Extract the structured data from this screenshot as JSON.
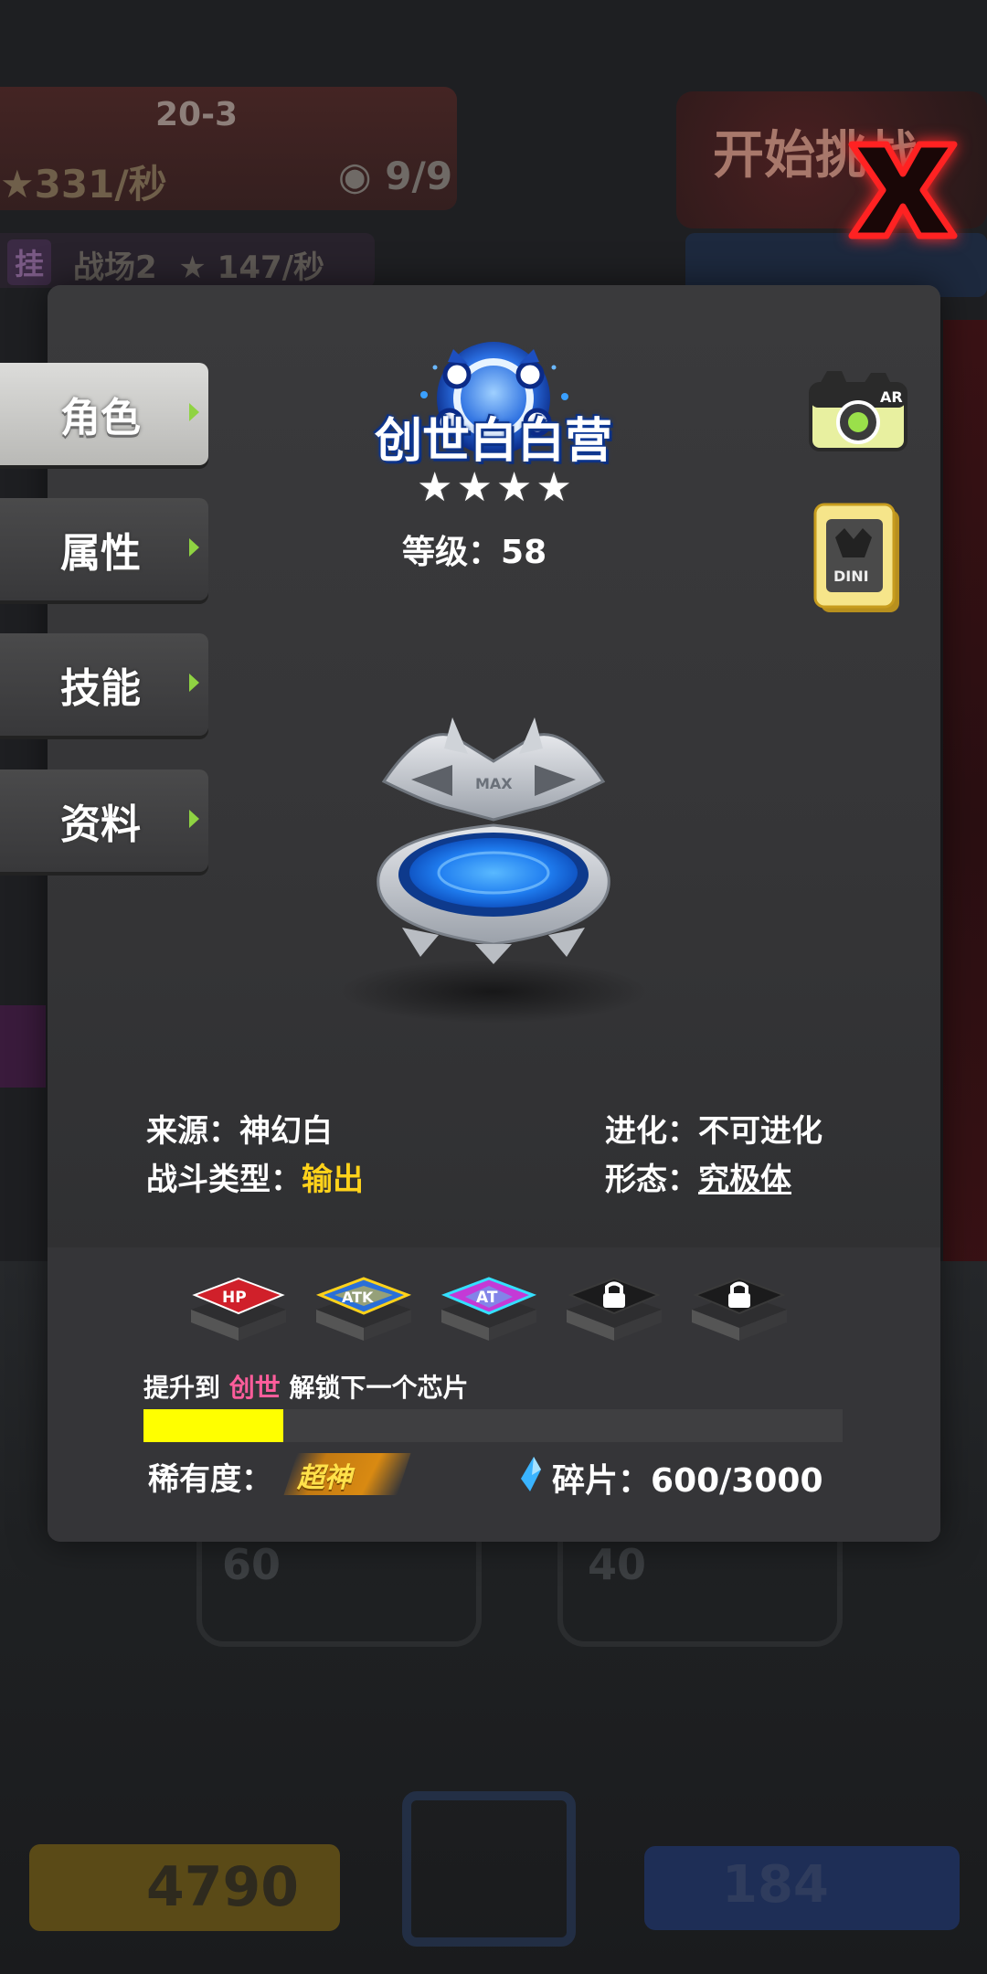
{
  "background": {
    "stage": "20-3",
    "rate": "331/秒",
    "pets": "9/9",
    "battlefield_tag": "挂",
    "battlefield": "战场2",
    "battlefield_rate": "147/秒",
    "start_button": "开始挑战",
    "slot_left_level": "60",
    "slot_right_level": "40",
    "coins": "4790",
    "gems": "184"
  },
  "tabs": [
    {
      "label": "角色",
      "active": true
    },
    {
      "label": "属性",
      "active": false
    },
    {
      "label": "技能",
      "active": false
    },
    {
      "label": "资料",
      "active": false
    }
  ],
  "character": {
    "name": "创世白白营",
    "stars": 4,
    "level_label": "等级：",
    "level_value": "58",
    "model_icon": "max-platform-icon"
  },
  "buttons": {
    "ar_label": "AR",
    "card_label": "DINI",
    "close_icon": "close-x-icon"
  },
  "info": {
    "source_label": "来源：",
    "source_value": "神幻白",
    "type_label": "战斗类型：",
    "type_value": "输出",
    "evolution_label": "进化：",
    "evolution_value": "不可进化",
    "form_label": "形态：",
    "form_value": "究极体"
  },
  "chips": [
    {
      "icon": "hp-chip-icon",
      "label": "HP",
      "locked": false
    },
    {
      "icon": "atk-chip-icon",
      "label": "ATK",
      "locked": false
    },
    {
      "icon": "at-chip-icon",
      "label": "AT",
      "locked": false
    },
    {
      "icon": "lock-icon",
      "label": "",
      "locked": true
    },
    {
      "icon": "lock-icon",
      "label": "",
      "locked": true
    }
  ],
  "upgrade": {
    "prefix": "提升到",
    "highlight": "创世",
    "suffix": "解锁下一个芯片",
    "progress": 0.2
  },
  "rarity": {
    "label": "稀有度：",
    "value": "超神"
  },
  "fragments": {
    "label": "碎片：",
    "value": "600/3000"
  },
  "colors": {
    "accent_yellow": "#ffd21a",
    "progress_fill": "#ffff00",
    "highlight_pink": "#ff5d9b",
    "tab_arrow": "#8fd342"
  }
}
